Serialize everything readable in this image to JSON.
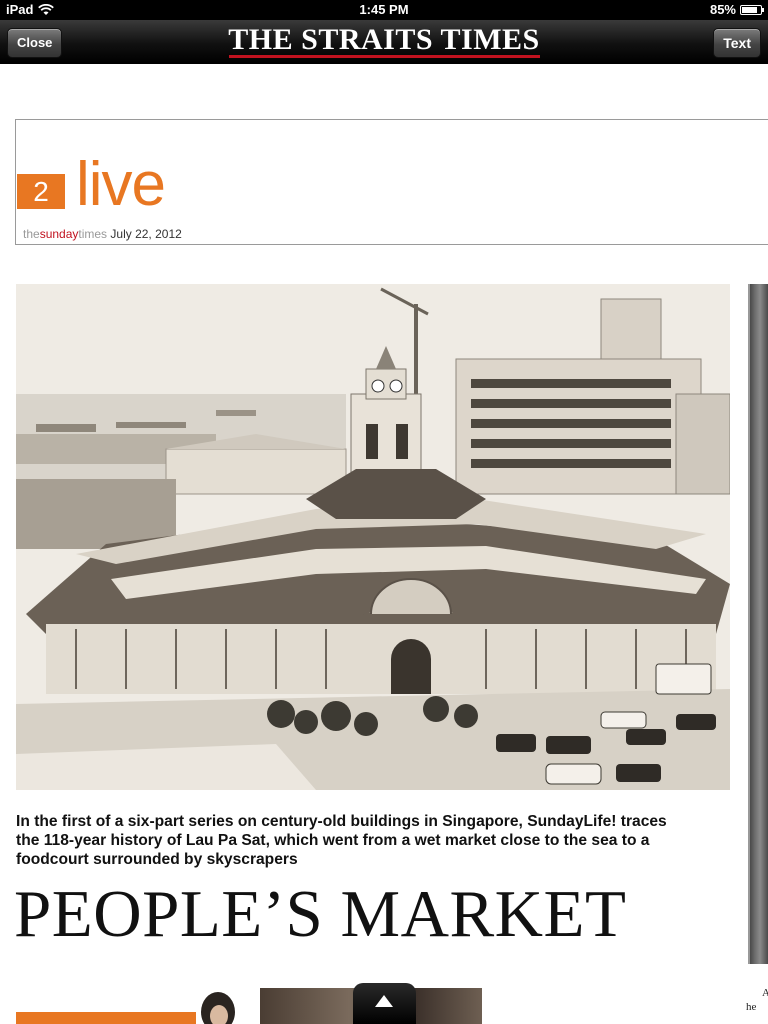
{
  "status_bar": {
    "device": "iPad",
    "time": "1:45 PM",
    "battery": "85%",
    "battery_level": 0.85
  },
  "nav": {
    "close_label": "Close",
    "title": "THE STRAITS TIMES",
    "text_label": "Text"
  },
  "section": {
    "number": "2",
    "name": "live",
    "brand_the": "the",
    "brand_sunday": "sunday",
    "brand_times": "times",
    "date": "July 22, 2012"
  },
  "article": {
    "standfirst": "In the first of a six-part series on century-old buildings in Singapore, SundayLife! traces the 118-year history of Lau Pa Sat, which went from a wet market close to the sea to a foodcourt surrounded by skyscrapers",
    "headline": "PEOPLE’S MARKET"
  },
  "next_page_snippet": {
    "line1": "A",
    "line2": "he"
  },
  "colors": {
    "accent_orange": "#e87722",
    "brand_red": "#c1121f",
    "photo_sepia": "#ede8df"
  }
}
